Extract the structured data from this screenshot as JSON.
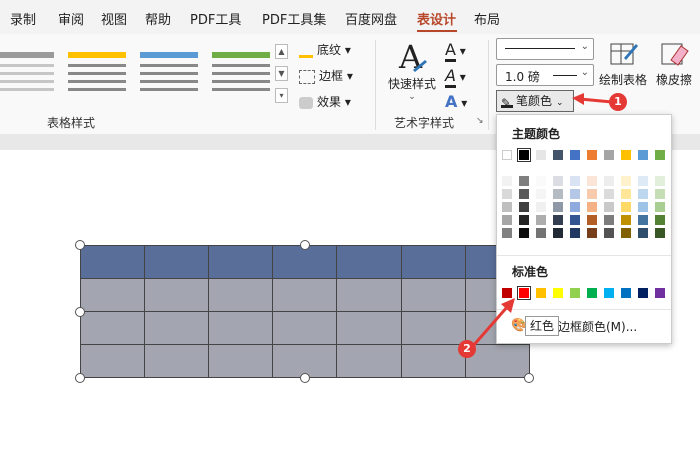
{
  "menu": {
    "items": [
      "录制",
      "审阅",
      "视图",
      "帮助",
      "PDF工具",
      "PDF工具集",
      "百度网盘",
      "表设计",
      "布局"
    ],
    "active_index": 7
  },
  "ribbon": {
    "table_styles_group_label": "表格样式",
    "shading_label": "底纹",
    "border_label": "边框",
    "effects_label": "效果",
    "quick_styles_label": "快速样式",
    "art_text_group_label": "艺术字样式",
    "pen_weight_value": "1.0 磅",
    "draw_table_label": "绘制表格",
    "eraser_label": "橡皮擦",
    "pen_color_label": "笔颜色"
  },
  "color_popup": {
    "theme_colors_title": "主题颜色",
    "standard_colors_title": "标准色",
    "more_colors_label": "边框颜色(M)...",
    "tooltip_text": "红色",
    "theme_top_row": [
      "#ffffff",
      "#000000",
      "#e7e6e6",
      "#44546a",
      "#4472c4",
      "#ed7d31",
      "#a5a5a5",
      "#ffc000",
      "#5b9bd5",
      "#70ad47"
    ],
    "standard_row": [
      "#c00000",
      "#ff0000",
      "#ffc000",
      "#ffff00",
      "#92d050",
      "#00b050",
      "#00b0f0",
      "#0070c0",
      "#002060",
      "#7030a0"
    ]
  },
  "callouts": {
    "badge_1": "1",
    "badge_2": "2"
  },
  "colors": {
    "table_header": "#5a6e9a",
    "table_body": "#a3a6b0",
    "accent": "#b7472a",
    "callout": "#e53935"
  }
}
